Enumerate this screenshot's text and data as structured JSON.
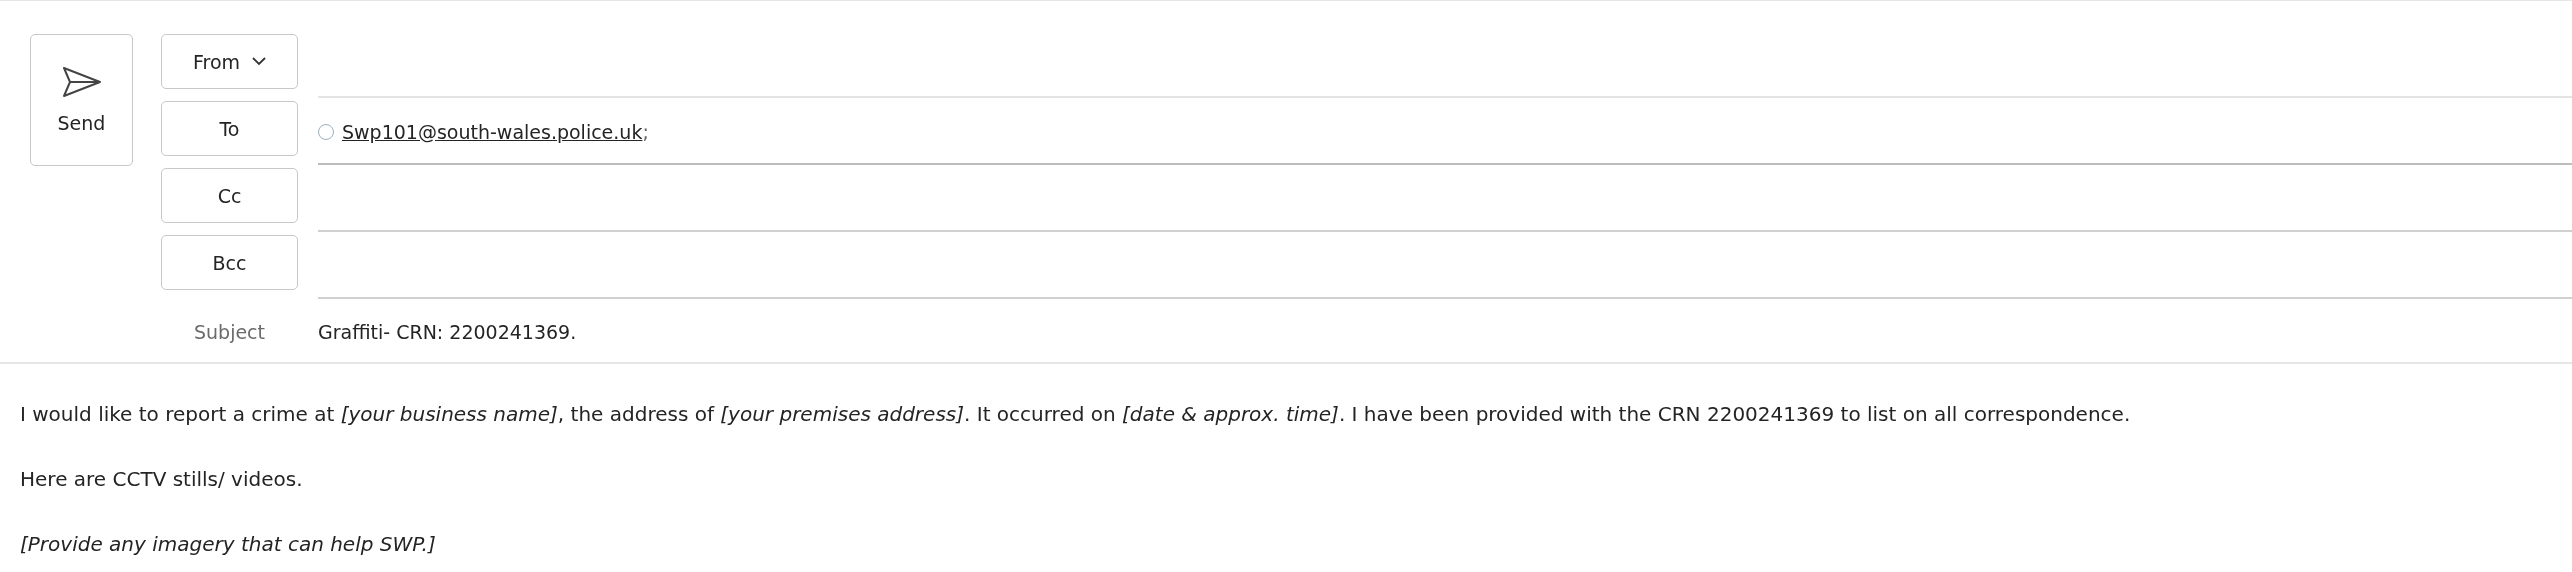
{
  "compose": {
    "send_button": "Send",
    "from_button": "From",
    "recipient_fields": [
      {
        "label": "To",
        "recipients": [
          {
            "address": "Swp101@south-wales.police.uk",
            "separator": ";"
          }
        ]
      },
      {
        "label": "Cc"
      },
      {
        "label": "Bcc"
      }
    ],
    "subject_label": "Subject",
    "subject": "Graffiti- CRN: 2200241369."
  },
  "body": {
    "paragraphs": [
      {
        "text": "I would like to report a crime at *[your business name]*, the address of *[your premises address]*. It occurred on *[date & approx. time]*. I have been provided with the CRN 2200241369 to list on all correspondence.",
        "italic": false
      },
      {
        "text": "Here are CCTV stills/ videos.",
        "italic": false
      },
      {
        "text": "[Provide any imagery that can help SWP.]",
        "italic": true
      }
    ]
  }
}
